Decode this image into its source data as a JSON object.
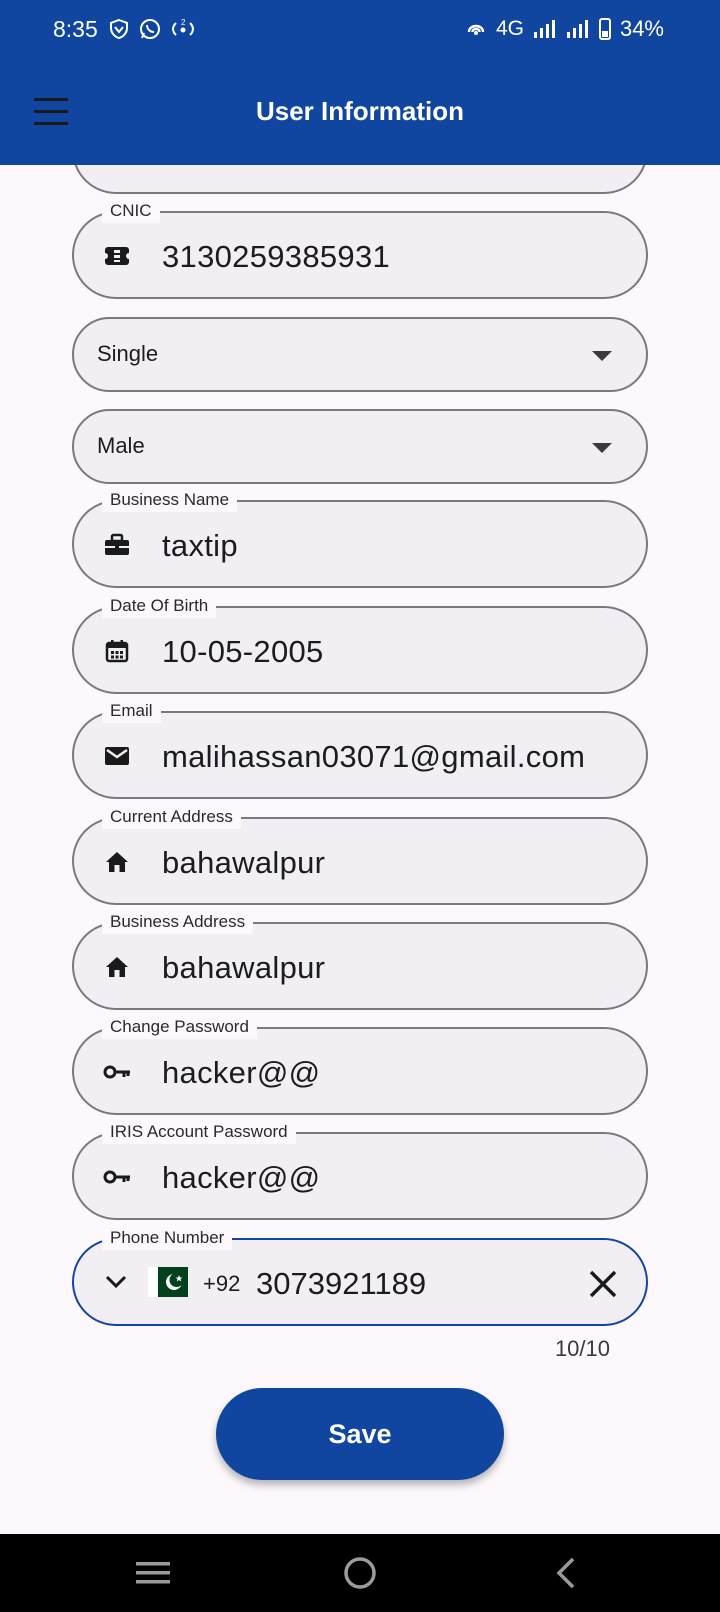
{
  "status_bar": {
    "time": "8:35",
    "network": "4G",
    "battery_percent": "34%"
  },
  "header": {
    "title": "User Information"
  },
  "form": {
    "cnic": {
      "label": "CNIC",
      "value": "3130259385931",
      "icon": "id-card-icon"
    },
    "marital_status": {
      "value": "Single"
    },
    "gender": {
      "value": "Male"
    },
    "business_name": {
      "label": "Business Name",
      "value": "taxtip",
      "icon": "briefcase-icon"
    },
    "dob": {
      "label": "Date Of Birth",
      "value": "10-05-2005",
      "icon": "calendar-icon"
    },
    "email": {
      "label": "Email",
      "value": "malihassan03071@gmail.com",
      "icon": "mail-icon"
    },
    "current_address": {
      "label": "Current Address",
      "value": "bahawalpur",
      "icon": "home-icon"
    },
    "business_address": {
      "label": "Business Address",
      "value": "bahawalpur",
      "icon": "home-icon"
    },
    "change_password": {
      "label": "Change Password",
      "value": "hacker@@",
      "icon": "key-icon"
    },
    "iris_password": {
      "label": "IRIS Account Password",
      "value": "hacker@@",
      "icon": "key-icon"
    },
    "phone": {
      "label": "Phone Number",
      "dial_code": "+92",
      "value": "3073921189",
      "counter": "10/10"
    }
  },
  "actions": {
    "save_label": "Save"
  },
  "colors": {
    "primary": "#1046a0",
    "field_fill": "#f1eff4",
    "field_border": "#7b787f",
    "background": "#fdf8fc"
  }
}
